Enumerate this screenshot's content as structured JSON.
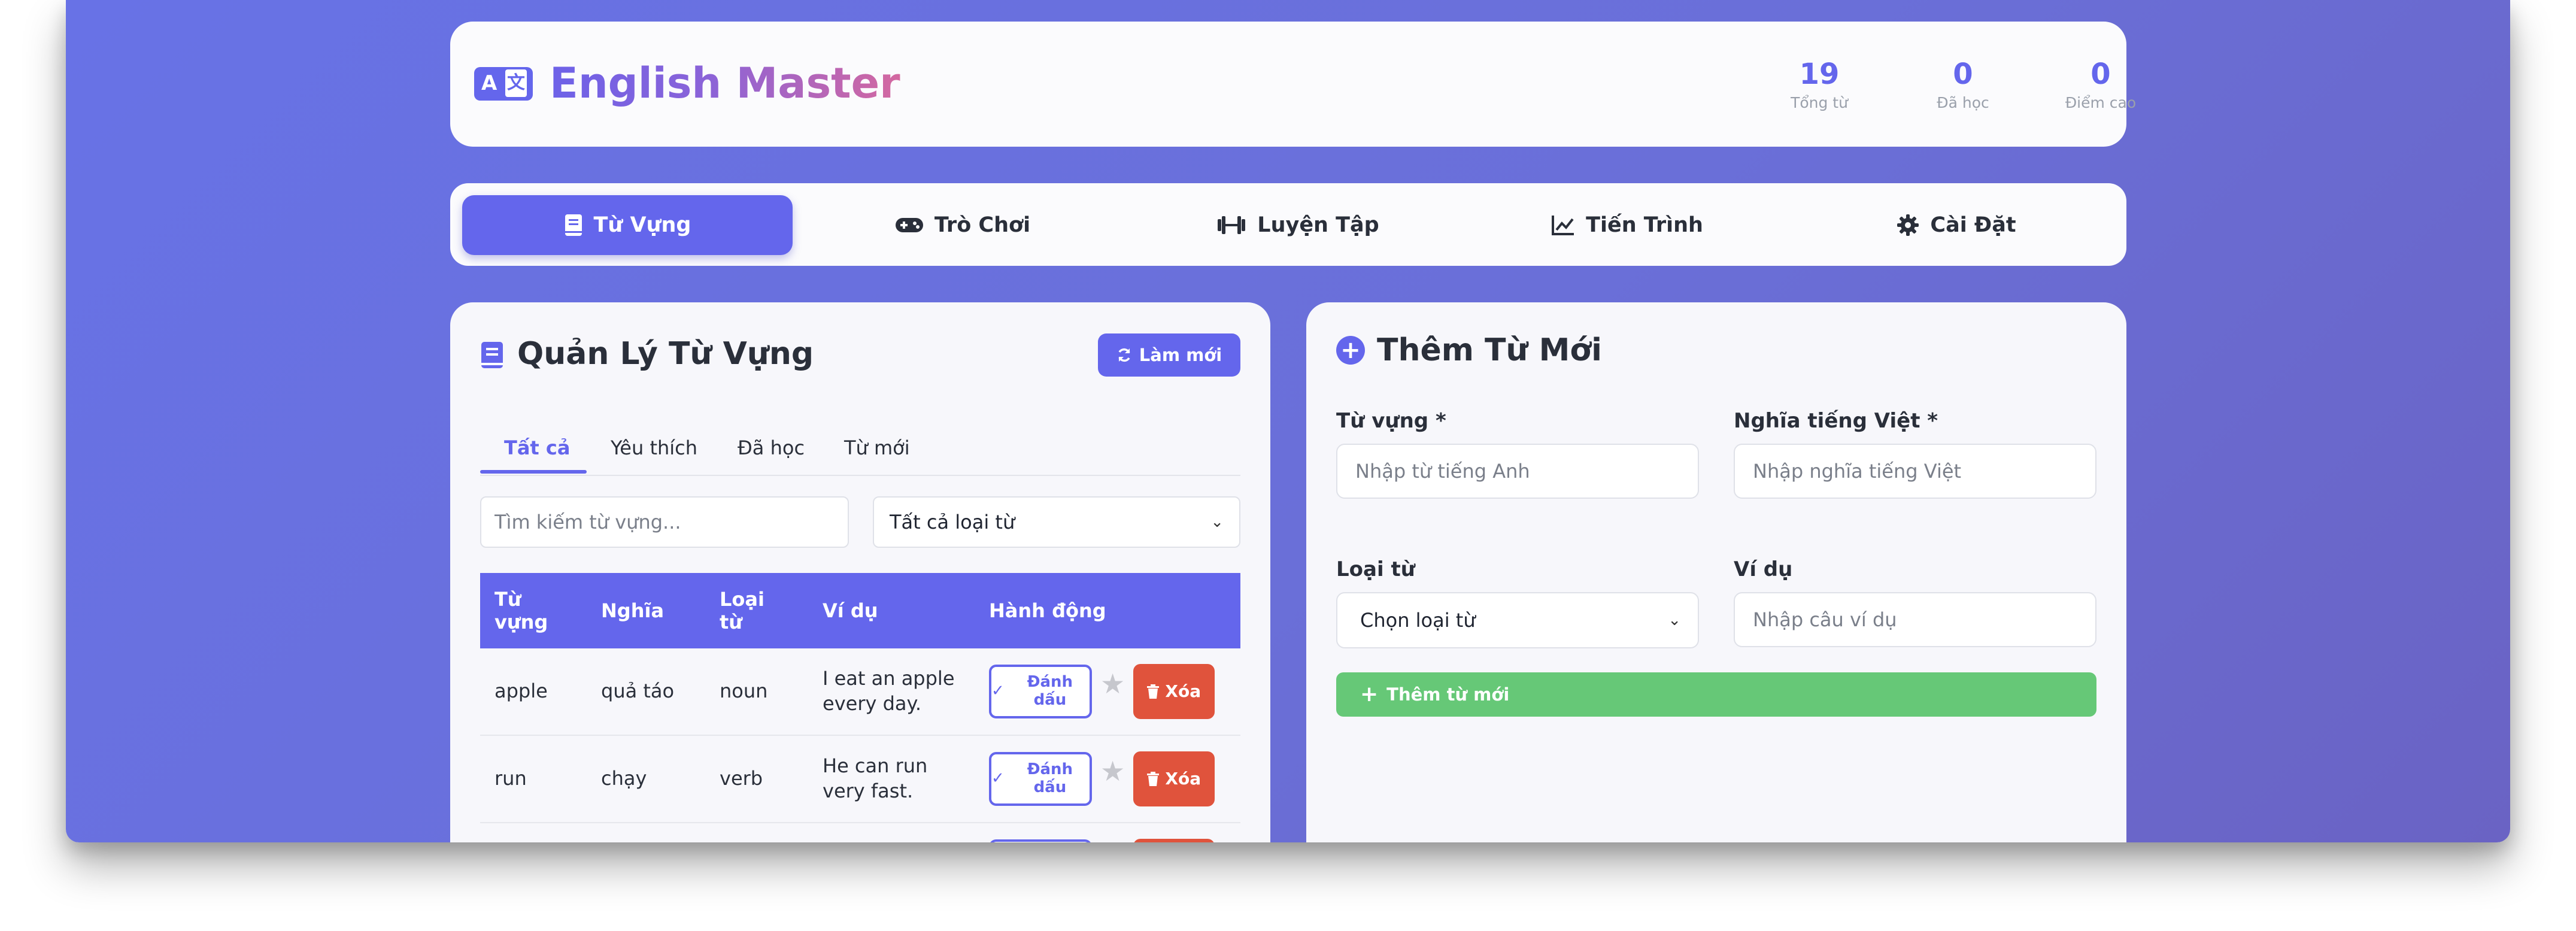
{
  "header": {
    "title_part1": "English",
    "title_part2": "Master",
    "stats": [
      {
        "value": "19",
        "label": "Tổng từ"
      },
      {
        "value": "0",
        "label": "Đã học"
      },
      {
        "value": "0",
        "label": "Điểm cao"
      }
    ]
  },
  "nav": {
    "items": [
      {
        "label": "Từ Vựng",
        "icon": "book-icon",
        "active": true
      },
      {
        "label": "Trò Chơi",
        "icon": "gamepad-icon"
      },
      {
        "label": "Luyện Tập",
        "icon": "dumbbell-icon"
      },
      {
        "label": "Tiến Trình",
        "icon": "chart-line-icon"
      },
      {
        "label": "Cài Đặt",
        "icon": "gear-icon"
      }
    ]
  },
  "vocab_panel": {
    "title": "Quản Lý Từ Vựng",
    "refresh_label": "Làm mới",
    "tabs": [
      "Tất cả",
      "Yêu thích",
      "Đã học",
      "Từ mới"
    ],
    "search_placeholder": "Tìm kiếm từ vựng...",
    "type_filter": "Tất cả loại từ",
    "columns": [
      "Từ vựng",
      "Nghĩa",
      "Loại từ",
      "Ví dụ",
      "Hành động"
    ],
    "rows": [
      {
        "word": "apple",
        "meaning": "quả táo",
        "type": "noun",
        "example": "I eat an apple every day."
      },
      {
        "word": "run",
        "meaning": "chạy",
        "type": "verb",
        "example": "He can run very fast."
      }
    ],
    "mark_label": "Đánh dấu",
    "delete_label": "Xóa"
  },
  "add_panel": {
    "title": "Thêm Từ Mới",
    "word_label": "Từ vựng *",
    "word_placeholder": "Nhập từ tiếng Anh",
    "meaning_label": "Nghĩa tiếng Việt *",
    "meaning_placeholder": "Nhập nghĩa tiếng Việt",
    "type_label": "Loại từ",
    "type_select": "Chọn loại từ",
    "example_label": "Ví dụ",
    "example_placeholder": "Nhập câu ví dụ",
    "submit_label": "Thêm từ mới"
  },
  "colors": {
    "accent": "#6466ec",
    "danger": "#e0533c",
    "success": "#66c877",
    "background": "#6a6fd8"
  }
}
